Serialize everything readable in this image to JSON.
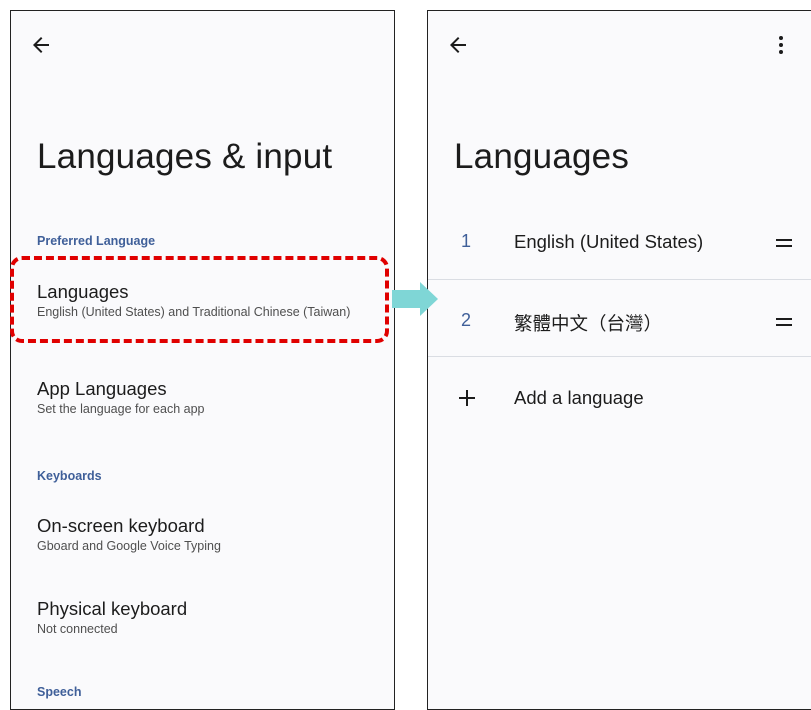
{
  "left_screen": {
    "title": "Languages & input",
    "sections": {
      "preferred_language": "Preferred Language",
      "keyboards": "Keyboards",
      "speech": "Speech"
    },
    "items": {
      "languages": {
        "title": "Languages",
        "subtitle": "English (United States) and Traditional Chinese (Taiwan)"
      },
      "app_languages": {
        "title": "App Languages",
        "subtitle": "Set the language for each app"
      },
      "onscreen_keyboard": {
        "title": "On-screen keyboard",
        "subtitle": "Gboard and Google Voice Typing"
      },
      "physical_keyboard": {
        "title": "Physical keyboard",
        "subtitle": "Not connected"
      }
    }
  },
  "right_screen": {
    "title": "Languages",
    "languages": [
      {
        "number": "1",
        "name": "English (United States)"
      },
      {
        "number": "2",
        "name": "繁體中文（台灣）"
      }
    ],
    "add_language_label": "Add a language"
  },
  "colors": {
    "accent": "#3f5f99",
    "highlight_border": "#e00000",
    "arrow": "#7fd6d6"
  }
}
